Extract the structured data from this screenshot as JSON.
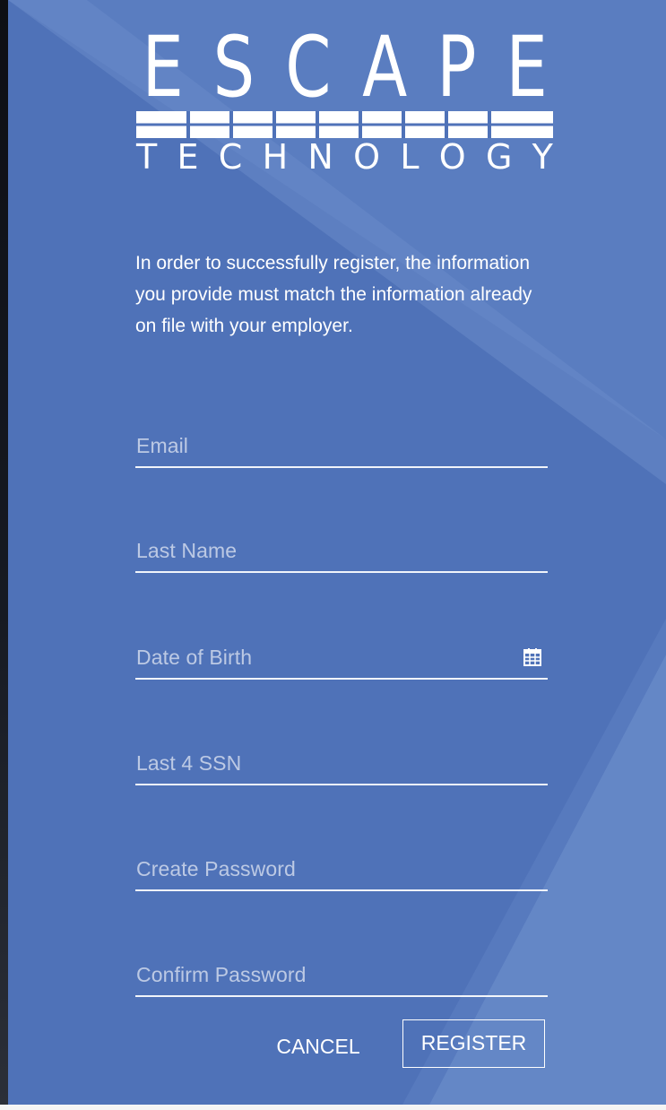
{
  "brand": {
    "logo_top": "ESCAPE",
    "logo_bottom": "TECHNOLOGY"
  },
  "intro": {
    "text": "In order to successfully register, the information you provide must match the information already on file with your employer."
  },
  "form": {
    "email": {
      "placeholder": "Email"
    },
    "last_name": {
      "placeholder": "Last Name"
    },
    "dob": {
      "placeholder": "Date of Birth",
      "icon": "calendar-icon"
    },
    "ssn": {
      "placeholder": "Last 4 SSN"
    },
    "password": {
      "placeholder": "Create Password"
    },
    "confirm_password": {
      "placeholder": "Confirm Password"
    }
  },
  "actions": {
    "cancel_label": "CANCEL",
    "register_label": "REGISTER"
  },
  "colors": {
    "panel": "#4f72b8",
    "panel_light": "#6586c4",
    "text": "#ffffff"
  }
}
